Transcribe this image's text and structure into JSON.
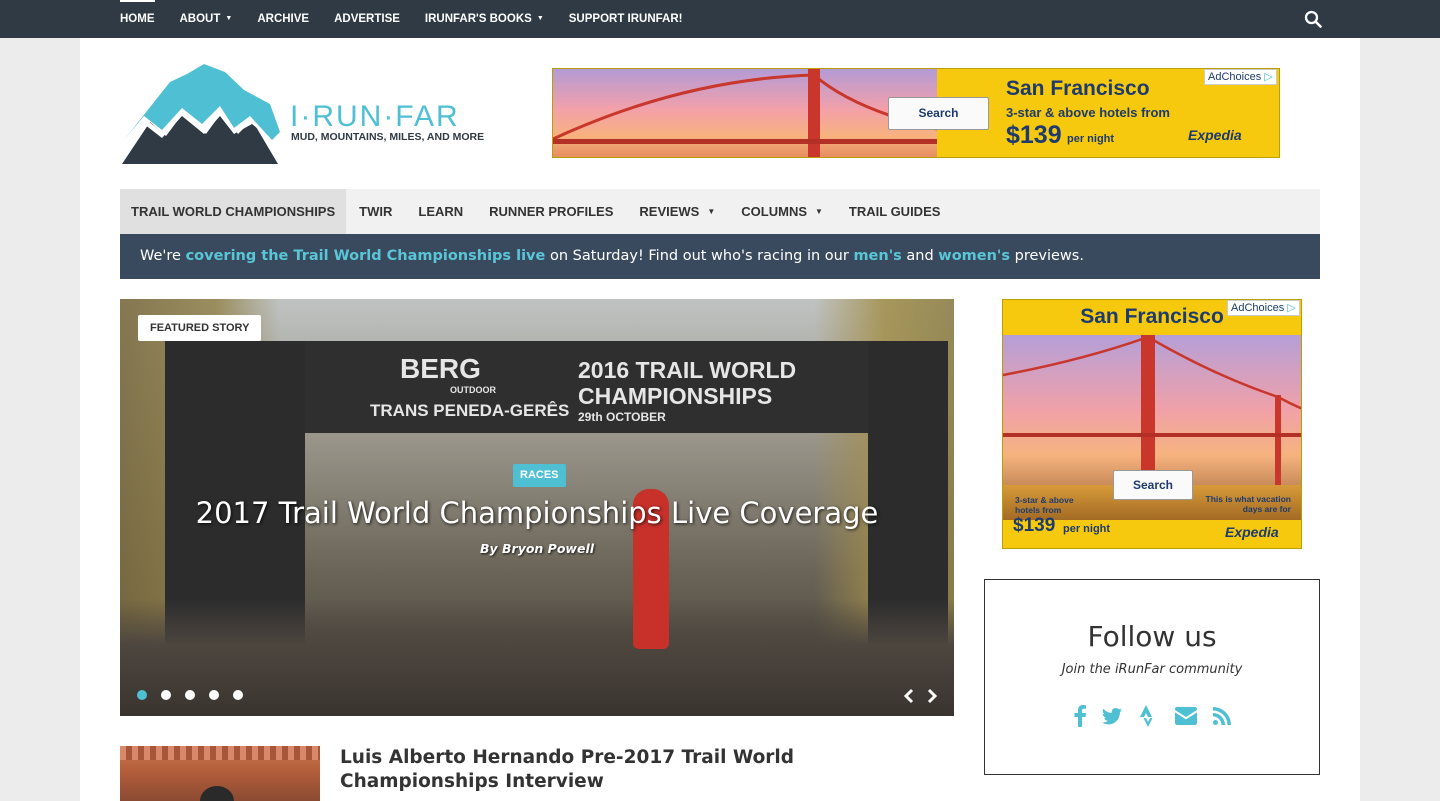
{
  "top_nav": {
    "items": [
      {
        "label": "HOME",
        "has_dropdown": false
      },
      {
        "label": "ABOUT",
        "has_dropdown": true
      },
      {
        "label": "ARCHIVE",
        "has_dropdown": false
      },
      {
        "label": "ADVERTISE",
        "has_dropdown": false
      },
      {
        "label": "IRUNFAR'S BOOKS",
        "has_dropdown": true
      },
      {
        "label": "SUPPORT IRUNFAR!",
        "has_dropdown": false
      }
    ],
    "caret": "▼",
    "search_icon": "search-icon"
  },
  "logo": {
    "name": "I·RUN·FAR",
    "tagline": "MUD, MOUNTAINS, MILES, AND MORE",
    "colors": {
      "teal": "#4fbfd3",
      "dark": "#2f3a44"
    }
  },
  "ad_top": {
    "city": "San Francisco",
    "subtitle": "3-star & above hotels from",
    "price": "$139",
    "per_night": "per night",
    "search_button": "Search",
    "adchoices": "AdChoices",
    "brand": "Expedia"
  },
  "section_nav": {
    "items": [
      {
        "label": "TRAIL WORLD CHAMPIONSHIPS",
        "active": true,
        "has_dropdown": false
      },
      {
        "label": "TWIR",
        "active": false,
        "has_dropdown": false
      },
      {
        "label": "LEARN",
        "active": false,
        "has_dropdown": false
      },
      {
        "label": "RUNNER PROFILES",
        "active": false,
        "has_dropdown": false
      },
      {
        "label": "REVIEWS",
        "active": false,
        "has_dropdown": true
      },
      {
        "label": "COLUMNS",
        "active": false,
        "has_dropdown": true
      },
      {
        "label": "TRAIL GUIDES",
        "active": false,
        "has_dropdown": false
      }
    ]
  },
  "announcement": {
    "prefix": "We're ",
    "link1": "covering the Trail World Championships live",
    "middle": " on Saturday! Find out who's racing in our ",
    "link2": "men's",
    "and": " and ",
    "link3": "women's",
    "suffix": " previews."
  },
  "featured": {
    "badge": "FEATURED STORY",
    "category": "RACES",
    "title": "2017 Trail World Championships Live Coverage",
    "author": "By Bryon Powell",
    "banner_lines": [
      "BERG",
      "OUTDOOR",
      "TRANS PENEDA-GERÊS",
      "2016 TRAIL WORLD",
      "CHAMPIONSHIPS",
      "29th OCTOBER"
    ],
    "slides": 5,
    "active_slide": 1
  },
  "next_article": {
    "title": "Luis Alberto Hernando Pre-2017 Trail World Championships Interview"
  },
  "ad_side": {
    "city": "San Francisco",
    "subtitle": "3-star & above hotels from",
    "price": "$139",
    "per_night": "per night",
    "search_button": "Search",
    "tagline": "This is what vacation days are for",
    "adchoices": "AdChoices",
    "brand": "Expedia"
  },
  "follow": {
    "heading": "Follow us",
    "subheading": "Join the iRunFar community",
    "icons": [
      "facebook-icon",
      "twitter-icon",
      "strava-icon",
      "email-icon",
      "rss-icon"
    ],
    "icon_color": "#4fbfd3"
  }
}
